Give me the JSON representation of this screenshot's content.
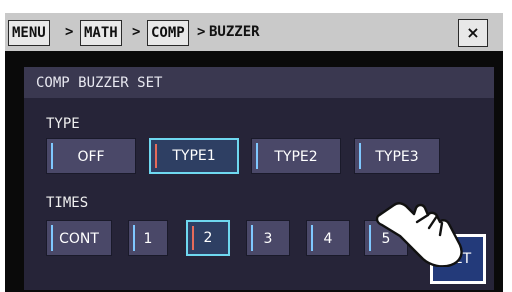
{
  "breadcrumb": {
    "items": [
      "MENU",
      "MATH",
      "COMP"
    ],
    "current": "BUZZER",
    "separator": ">"
  },
  "close_label": "×",
  "panel": {
    "title": "COMP BUZZER SET",
    "type_label": "TYPE",
    "type_options": [
      "OFF",
      "TYPE1",
      "TYPE2",
      "TYPE3"
    ],
    "type_selected": "TYPE1",
    "times_label": "TIMES",
    "times_options": [
      "CONT",
      "1",
      "2",
      "3",
      "4",
      "5"
    ],
    "times_selected": "2"
  },
  "set_label": "SET",
  "colors": {
    "titlebar": "#c9c9c9",
    "panel_bg": "#262438",
    "button_bg": "#4a4868",
    "selected_border": "#6fd8f0",
    "set_button": "#233a7a"
  },
  "icons": [
    "hand-pointer-icon",
    "close-icon"
  ]
}
